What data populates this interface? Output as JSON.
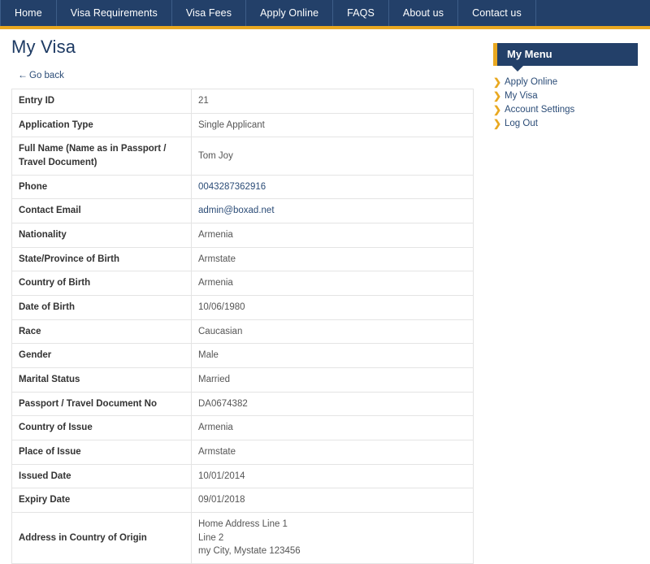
{
  "navbar": {
    "items": [
      {
        "label": "Home"
      },
      {
        "label": "Visa Requirements"
      },
      {
        "label": "Visa Fees"
      },
      {
        "label": "Apply Online"
      },
      {
        "label": "FAQS"
      },
      {
        "label": "About us"
      },
      {
        "label": "Contact us"
      }
    ],
    "background_color": "#234069",
    "accent_color": "#e9a820"
  },
  "page": {
    "title": "My Visa",
    "go_back_label": "Go back",
    "go_back_arrow": "←"
  },
  "details": {
    "rows": [
      {
        "label": "Entry ID",
        "value": "21",
        "type": "text"
      },
      {
        "label": "Application Type",
        "value": "Single Applicant",
        "type": "text"
      },
      {
        "label": "Full Name (Name as in Passport / Travel Document)",
        "value": "Tom Joy",
        "type": "text"
      },
      {
        "label": "Phone",
        "value": "0043287362916",
        "type": "link"
      },
      {
        "label": "Contact Email",
        "value": "admin@boxad.net",
        "type": "link"
      },
      {
        "label": "Nationality",
        "value": "Armenia",
        "type": "text"
      },
      {
        "label": "State/Province of Birth",
        "value": "Armstate",
        "type": "text"
      },
      {
        "label": "Country of Birth",
        "value": "Armenia",
        "type": "text"
      },
      {
        "label": "Date of Birth",
        "value": "10/06/1980",
        "type": "text"
      },
      {
        "label": "Race",
        "value": "Caucasian",
        "type": "text"
      },
      {
        "label": "Gender",
        "value": "Male",
        "type": "text"
      },
      {
        "label": "Marital Status",
        "value": "Married",
        "type": "text"
      },
      {
        "label": "Passport / Travel Document No",
        "value": "DA0674382",
        "type": "text"
      },
      {
        "label": "Country of Issue",
        "value": "Armenia",
        "type": "text"
      },
      {
        "label": "Place of Issue",
        "value": "Armstate",
        "type": "text"
      },
      {
        "label": "Issued Date",
        "value": "10/01/2014",
        "type": "text"
      },
      {
        "label": "Expiry Date",
        "value": "09/01/2018",
        "type": "text"
      },
      {
        "label": "Address in Country of Origin",
        "value": "Home Address Line 1\nLine 2\nmy City, Mystate 123456",
        "type": "multiline"
      }
    ]
  },
  "menu": {
    "header": "My Menu",
    "bullet_glyph": "❯",
    "items": [
      {
        "label": "Apply Online"
      },
      {
        "label": "My Visa"
      },
      {
        "label": "Account Settings"
      },
      {
        "label": "Log Out"
      }
    ]
  }
}
